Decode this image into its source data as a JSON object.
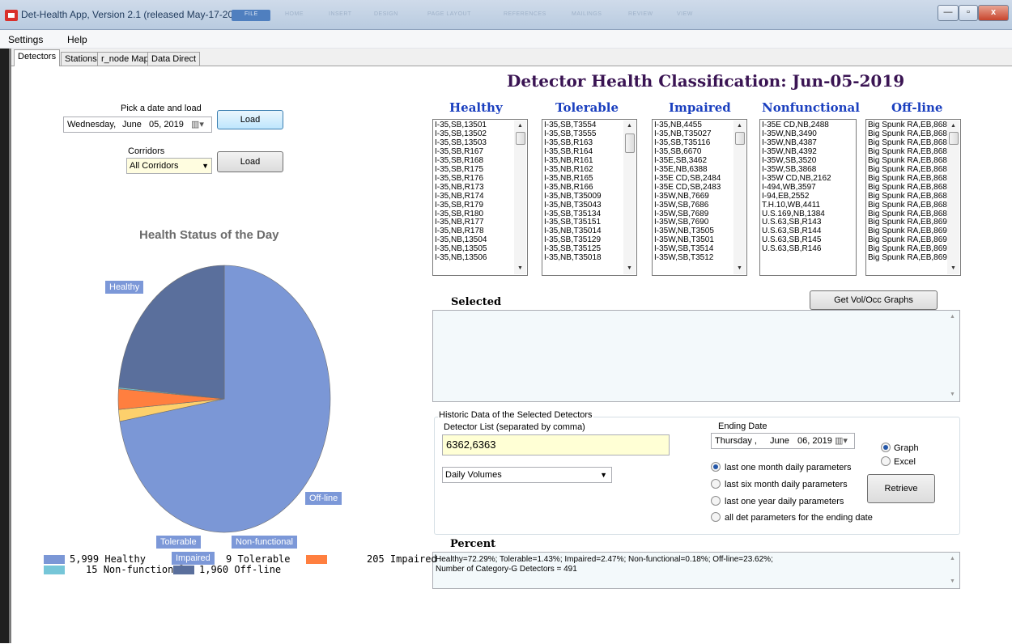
{
  "window": {
    "title": "Det-Health App, Version 2.1 (released May-17-2019)",
    "ribbon_tabs": [
      "FILE",
      "HOME",
      "INSERT",
      "DESIGN",
      "PAGE LAYOUT",
      "REFERENCES",
      "MAILINGS",
      "REVIEW",
      "VIEW"
    ],
    "controls": {
      "minimize": "—",
      "maximize": "▫",
      "close": "x"
    }
  },
  "menu": [
    "Settings",
    "Help"
  ],
  "tabs": [
    "Detectors",
    "Stations",
    "r_node Map",
    "Data Direct"
  ],
  "date_picker": {
    "label": "Pick a date and load",
    "day": "Wednesday,",
    "month": "June",
    "date": "05, 2019",
    "load_label": "Load"
  },
  "corridors": {
    "label": "Corridors",
    "value": "All Corridors",
    "load_label": "Load"
  },
  "main_title": "Detector Health Classification: Jun-05-2019",
  "pie_title": "Health Status of the Day",
  "categories": [
    {
      "name": "Healthy",
      "items": [
        "I-35,SB,13501",
        "I-35,SB,13502",
        "I-35,SB,13503",
        "I-35,SB,R167",
        "I-35,SB,R168",
        "I-35,SB,R175",
        "I-35,SB,R176",
        "I-35,NB,R173",
        "I-35,NB,R174",
        "I-35,SB,R179",
        "I-35,SB,R180",
        "I-35,NB,R177",
        "I-35,NB,R178",
        "I-35,NB,13504",
        "I-35,NB,13505",
        "I-35,NB,13506"
      ]
    },
    {
      "name": "Tolerable",
      "items": [
        "I-35,SB,T3554",
        "I-35,SB,T3555",
        "I-35,SB,R163",
        "I-35,SB,R164",
        "I-35,NB,R161",
        "I-35,NB,R162",
        "I-35,NB,R165",
        "I-35,NB,R166",
        "I-35,NB,T35009",
        "I-35,NB,T35043",
        "I-35,SB,T35134",
        "I-35,SB,T35151",
        "I-35,NB,T35014",
        "I-35,SB,T35129",
        "I-35,SB,T35125",
        "I-35,NB,T35018"
      ]
    },
    {
      "name": "Impaired",
      "items": [
        "I-35,NB,4455",
        "I-35,NB,T35027",
        "I-35,SB,T35116",
        "I-35,SB,6670",
        "I-35E,SB,3462",
        "I-35E,NB,6388",
        "I-35E CD,SB,2484",
        "I-35E CD,SB,2483",
        "I-35W,NB,7669",
        "I-35W,SB,7686",
        "I-35W,SB,7689",
        "I-35W,SB,7690",
        "I-35W,NB,T3505",
        "I-35W,NB,T3501",
        "I-35W,SB,T3514",
        "I-35W,SB,T3512"
      ]
    },
    {
      "name": "Nonfunctional",
      "items": [
        "I-35E CD,NB,2488",
        "I-35W,NB,3490",
        "I-35W,NB,4387",
        "I-35W,NB,4392",
        "I-35W,SB,3520",
        "I-35W,SB,3868",
        "I-35W CD,NB,2162",
        "I-494,WB,3597",
        "I-94,EB,2552",
        "T.H.10,WB,4411",
        "U.S.169,NB,1384",
        "U.S.63,SB,R143",
        "U.S.63,SB,R144",
        "U.S.63,SB,R145",
        "U.S.63,SB,R146"
      ]
    },
    {
      "name": "Off-line",
      "items": [
        "Big Spunk RA,EB,868",
        "Big Spunk RA,EB,868",
        "Big Spunk RA,EB,868",
        "Big Spunk RA,EB,868",
        "Big Spunk RA,EB,868",
        "Big Spunk RA,EB,868",
        "Big Spunk RA,EB,868",
        "Big Spunk RA,EB,868",
        "Big Spunk RA,EB,868",
        "Big Spunk RA,EB,868",
        "Big Spunk RA,EB,868",
        "Big Spunk RA,EB,869",
        "Big Spunk RA,EB,869",
        "Big Spunk RA,EB,869",
        "Big Spunk RA,EB,869",
        "Big Spunk RA,EB,869"
      ]
    }
  ],
  "selected": {
    "label": "Selected",
    "graph_button": "Get Vol/Occ Graphs"
  },
  "historic": {
    "group_label": "Historic Data of the Selected Detectors",
    "list_label": "Detector List (separated by comma)",
    "list_value": "6362,6363",
    "param_value": "Daily Volumes",
    "ending_label": "Ending Date",
    "end_day": "Thursday ,",
    "end_month": "June",
    "end_date": "06, 2019",
    "range_options": [
      "last one month daily parameters",
      "last six month daily parameters",
      "last one year daily parameters",
      "all det parameters for the ending date"
    ],
    "range_selected": 0,
    "output_options": [
      "Graph",
      "Excel"
    ],
    "output_selected": 0,
    "retrieve_label": "Retrieve"
  },
  "percent": {
    "label": "Percent",
    "line1": "Healthy=72.29%; Tolerable=1.43%; Impaired=2.47%; Non-functional=0.18%; Off-line=23.62%;",
    "line2": "Number of Category-G Detectors = 491"
  },
  "chart_data": {
    "type": "pie",
    "title": "Health Status of the Day",
    "slices": [
      {
        "label": "Healthy",
        "value": 5999,
        "color": "#7b97d6"
      },
      {
        "label": "Tolerable",
        "value": 119,
        "color": "#fdd06c"
      },
      {
        "label": "Impaired",
        "value": 205,
        "color": "#ff7f3f"
      },
      {
        "label": "Non-functional",
        "value": 15,
        "color": "#76c6d8"
      },
      {
        "label": "Off-line",
        "value": 1960,
        "color": "#5a6f9c"
      }
    ],
    "legend_rows": [
      {
        "count": "5,999",
        "label": "Healthy",
        "color": "#7b97d6"
      },
      {
        "count": "9",
        "label": "Tolerable",
        "color": "#fdd06c"
      },
      {
        "count": "205",
        "label": "Impaired",
        "color": "#ff7f3f"
      },
      {
        "count": "15",
        "label": "Non-functional",
        "color": "#76c6d8"
      },
      {
        "count": "1,960",
        "label": "Off-line",
        "color": "#5a6f9c"
      }
    ],
    "slice_labels": [
      "Healthy",
      "Off-line",
      "Tolerable",
      "Non-functional",
      "Impaired"
    ]
  }
}
